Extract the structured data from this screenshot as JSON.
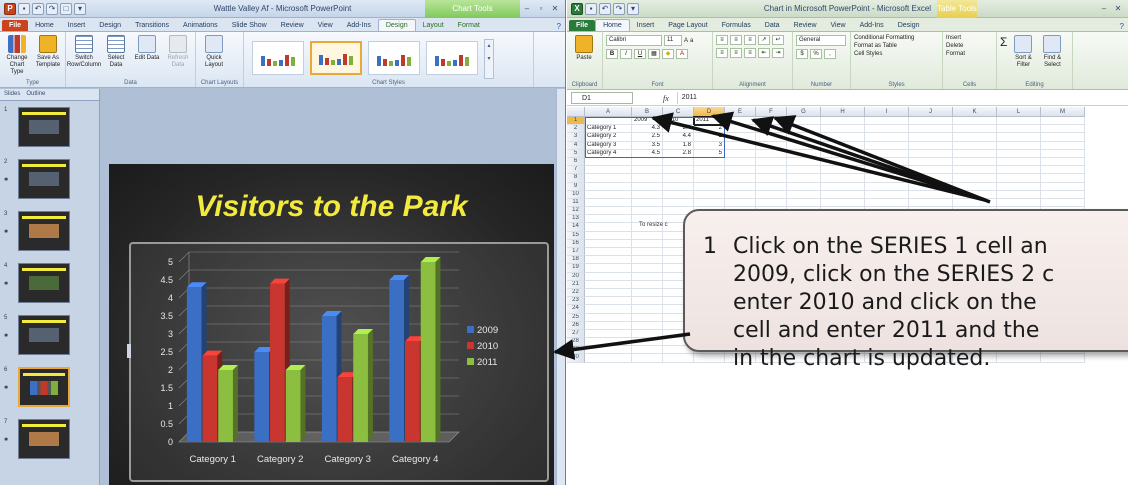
{
  "ppt": {
    "title": "Wattle Valley Af - Microsoft PowerPoint",
    "context_title": "Chart Tools",
    "tabs": [
      "File",
      "Home",
      "Insert",
      "Design",
      "Transitions",
      "Animations",
      "Slide Show",
      "Review",
      "View",
      "Add-Ins"
    ],
    "context_tabs": [
      "Design",
      "Layout",
      "Format"
    ],
    "ribbon": {
      "type_group": "Type",
      "change_chart_type": "Change Chart Type",
      "save_as_template": "Save As Template",
      "data_group": "Data",
      "switch_row_column": "Switch Row/Column",
      "select_data": "Select Data",
      "edit_data": "Edit Data",
      "refresh_data": "Refresh Data",
      "layouts_group": "Chart Layouts",
      "quick_layout": "Quick Layout",
      "styles_group": "Chart Styles"
    },
    "panel_tabs": [
      "Slides",
      "Outline"
    ],
    "slide_numbers": [
      "1",
      "2",
      "3",
      "4",
      "5",
      "6",
      "7"
    ],
    "slide_title": "Visitors to the Park"
  },
  "excel": {
    "title": "Chart in Microsoft PowerPoint - Microsoft Excel",
    "context_title": "Table Tools",
    "tabs": [
      "File",
      "Home",
      "Insert",
      "Page Layout",
      "Formulas",
      "Data",
      "Review",
      "View",
      "Add-Ins",
      "Design"
    ],
    "ribbon": {
      "clipboard": "Clipboard",
      "paste": "Paste",
      "font": "Font",
      "font_name": "Calibri",
      "font_size": "11",
      "alignment": "Alignment",
      "number": "Number",
      "number_format": "General",
      "styles": "Styles",
      "conditional_formatting": "Conditional Formatting",
      "format_as_table": "Format as Table",
      "cell_styles": "Cell Styles",
      "cells": "Cells",
      "insert": "Insert",
      "delete": "Delete",
      "format": "Format",
      "editing": "Editing",
      "sort_filter": "Sort & Filter",
      "find_select": "Find & Select"
    },
    "name_box": "D1",
    "formula_value": "2011",
    "columns": [
      "A",
      "B",
      "C",
      "D",
      "E",
      "F",
      "G",
      "H",
      "I",
      "J",
      "K",
      "L",
      "M"
    ],
    "cells": [
      [
        "",
        "2009",
        "2010",
        "2011"
      ],
      [
        "Category 1",
        "4.3",
        "2.4",
        "2"
      ],
      [
        "Category 2",
        "2.5",
        "4.4",
        "2"
      ],
      [
        "Category 3",
        "3.5",
        "1.8",
        "3"
      ],
      [
        "Category 4",
        "4.5",
        "2.8",
        "5"
      ]
    ],
    "row_count": 30,
    "resize_note": "To resize c"
  },
  "callout": {
    "number": "1",
    "lines": [
      "Click on the SERIES 1 cell an",
      "2009, click on the SERIES 2 c",
      "enter 2010 and click on the",
      "cell and enter 2011 and the",
      "in the chart is updated."
    ]
  },
  "chart_data": {
    "type": "bar",
    "categories": [
      "Category 1",
      "Category 2",
      "Category 3",
      "Category 4"
    ],
    "series": [
      {
        "name": "2009",
        "values": [
          4.3,
          2.5,
          3.5,
          4.5
        ],
        "color": "#3b6fc4"
      },
      {
        "name": "2010",
        "values": [
          2.4,
          4.4,
          1.8,
          2.8
        ],
        "color": "#c8362f"
      },
      {
        "name": "2011",
        "values": [
          2.0,
          2.0,
          3.0,
          5.0
        ],
        "color": "#8cbf3f"
      }
    ],
    "ylim": [
      0,
      5
    ],
    "yticks": [
      "0",
      "0.5",
      "1",
      "1.5",
      "2",
      "2.5",
      "3",
      "3.5",
      "4",
      "4.5",
      "5"
    ],
    "grid": true,
    "legend": "right"
  },
  "colors": {
    "title_yellow": "#f2ea3c",
    "ppt_accent": "#c8431e",
    "excel_accent": "#2a7a3b",
    "arrow": "#111111"
  }
}
